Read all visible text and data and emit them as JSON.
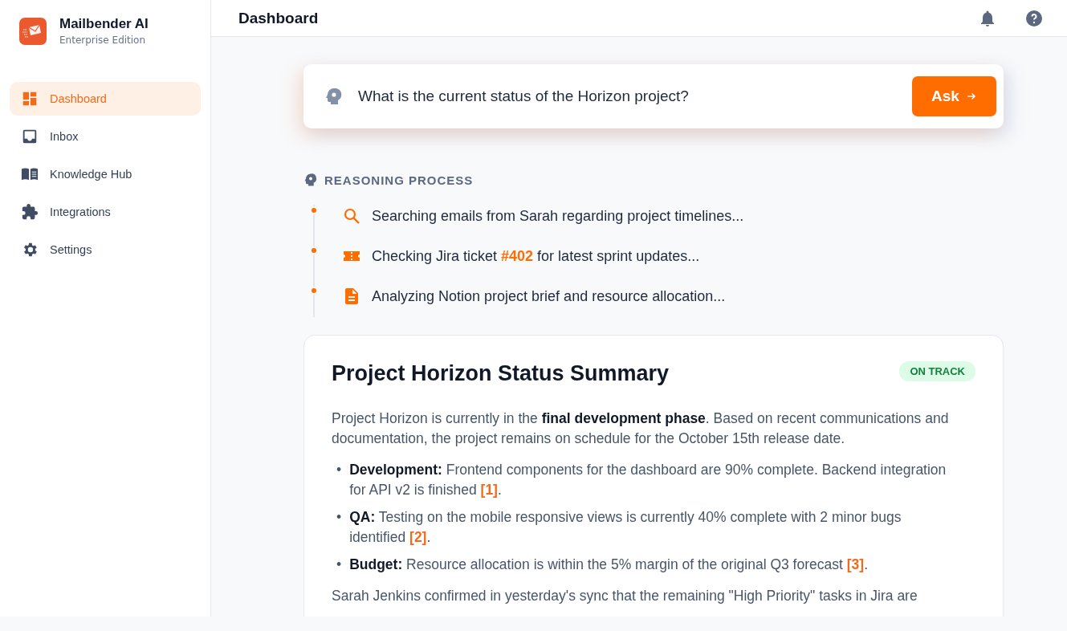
{
  "brand": {
    "name": "Mailbender AI",
    "edition": "Enterprise Edition"
  },
  "sidebar": {
    "items": [
      {
        "label": "Dashboard",
        "kind": "dashboard",
        "selected": true
      },
      {
        "label": "Inbox",
        "kind": "inbox",
        "selected": false
      },
      {
        "label": "Knowledge Hub",
        "kind": "book",
        "selected": false
      },
      {
        "label": "Integrations",
        "kind": "puzzle",
        "selected": false
      },
      {
        "label": "Settings",
        "kind": "gear",
        "selected": false
      }
    ]
  },
  "header": {
    "title": "Dashboard"
  },
  "query": {
    "value": "What is the current status of the Horizon project?",
    "button": "Ask"
  },
  "reasoning": {
    "title": "REASONING PROCESS",
    "steps": [
      {
        "kind": "search",
        "before": "Searching emails from Sarah regarding project timelines..."
      },
      {
        "kind": "ticket",
        "before": "Checking Jira ticket ",
        "highlight": "#402",
        "after": " for latest sprint updates..."
      },
      {
        "kind": "document",
        "before": "Analyzing Notion project brief and resource allocation..."
      }
    ]
  },
  "summary": {
    "title": "Project Horizon Status Summary",
    "status": "ON TRACK",
    "intro": "Project Horizon is currently in the **final development phase**. Based on recent communications and documentation, the project remains on schedule for the October 15th release date.",
    "bullets": [
      {
        "marker": "•",
        "label": "Development:",
        "text": " Frontend components for the dashboard are 90% complete. Backend integration for API v2 is finished ",
        "citation": "[1]",
        "end": "."
      },
      {
        "marker": "•",
        "label": "QA:",
        "text": " Testing on the mobile responsive views is currently 40% complete with 2 minor bugs identified ",
        "citation": "[2]",
        "end": "."
      },
      {
        "marker": "•",
        "label": "Budget:",
        "text": " Resource allocation is within the 5% margin of the original Q3 forecast ",
        "citation": "[3]",
        "end": "."
      }
    ],
    "closing": "Sarah Jenkins confirmed in yesterday's sync that the remaining \"High Priority\" tasks in Jira are"
  }
}
